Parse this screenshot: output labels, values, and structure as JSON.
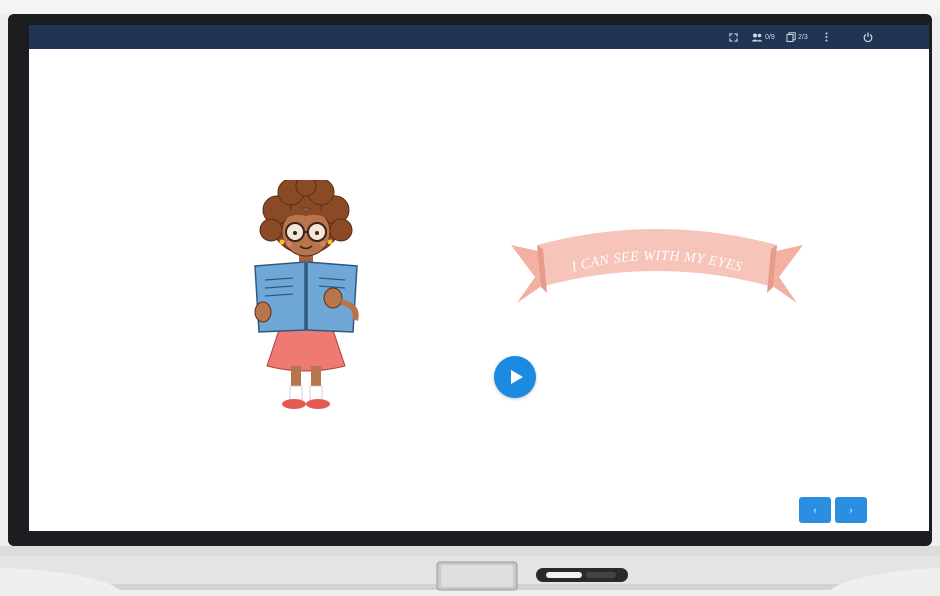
{
  "topbar": {
    "participants_count": "0/9",
    "pages_count": "2/3"
  },
  "slide": {
    "banner_text": "I CAN SEE WITH MY EYES",
    "play_icon": "play-icon"
  },
  "navigation": {
    "prev_label": "‹",
    "next_label": "›"
  },
  "colors": {
    "topbar": "#1f3553",
    "accent": "#1a8be0",
    "banner": "#f6c4b8"
  }
}
